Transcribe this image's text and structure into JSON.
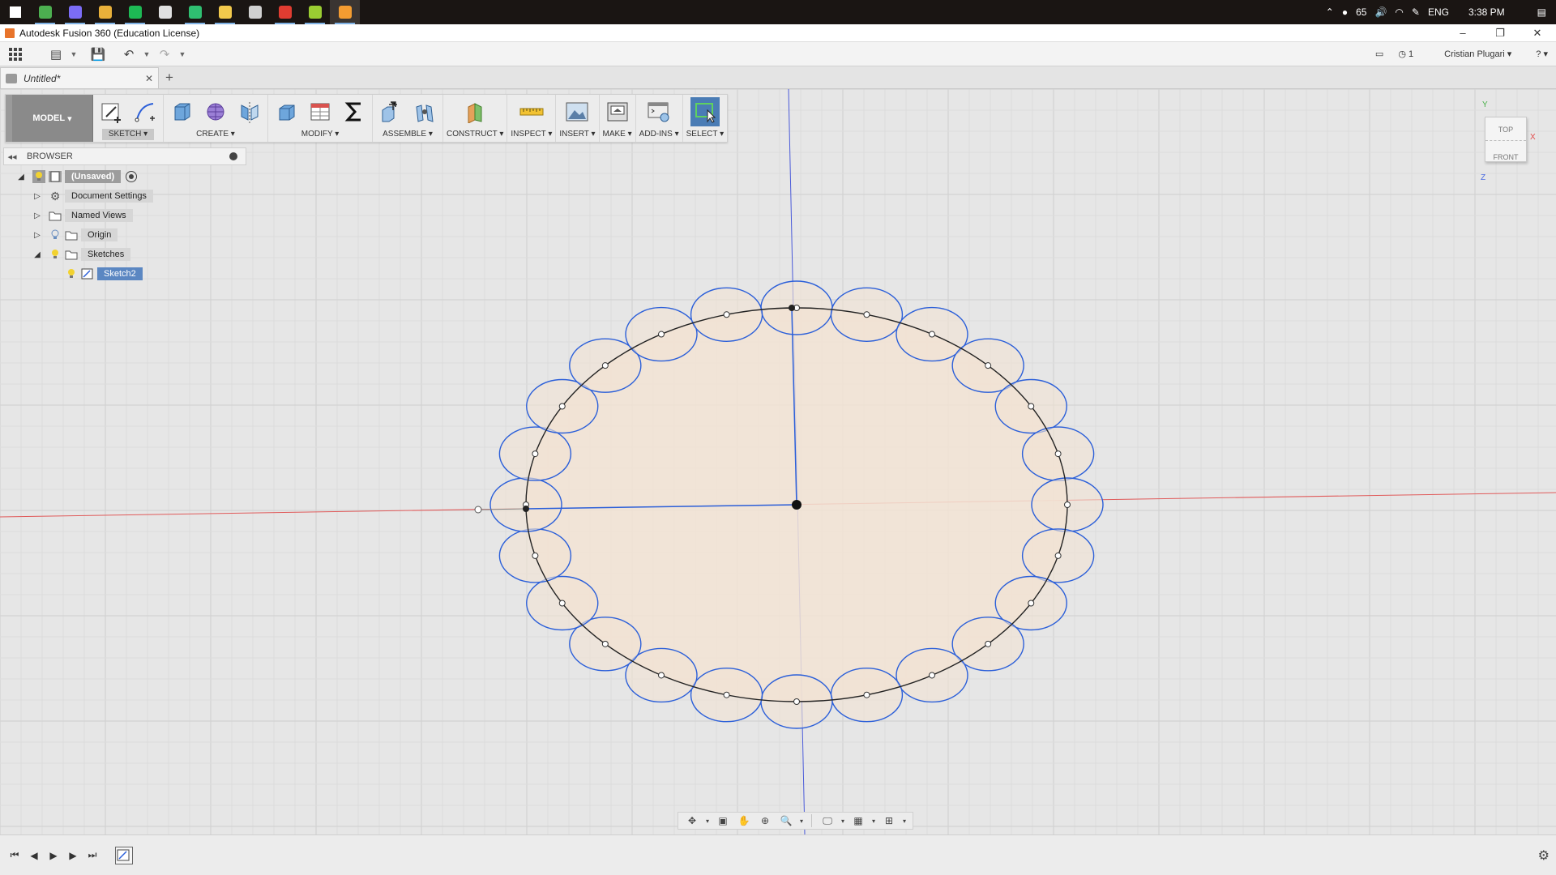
{
  "taskbar": {
    "apps": [
      {
        "name": "start",
        "color": "#ffffff"
      },
      {
        "name": "app-green",
        "color": "#4caf50"
      },
      {
        "name": "app-purple",
        "color": "#7b6cf6"
      },
      {
        "name": "app-chrome",
        "color": "#e8b03a"
      },
      {
        "name": "app-spotify",
        "color": "#1db954"
      },
      {
        "name": "app-git",
        "color": "#e0e0e0"
      },
      {
        "name": "app-green2",
        "color": "#2fbf71"
      },
      {
        "name": "app-files",
        "color": "#f2c94c"
      },
      {
        "name": "app-calc",
        "color": "#d0d0d0"
      },
      {
        "name": "app-pdf",
        "color": "#e03c31"
      },
      {
        "name": "app-edit",
        "color": "#9acd32"
      },
      {
        "name": "app-fusion",
        "color": "#f39c31"
      }
    ],
    "temp": "65",
    "lang": "ENG",
    "time": "3:38 PM"
  },
  "window": {
    "title": "Autodesk Fusion 360 (Education License)",
    "min": "–",
    "max": "❐",
    "close": "✕"
  },
  "apptoolbar": {
    "jobs_count": "1",
    "user": "Cristian Plugari",
    "help": "?"
  },
  "tab": {
    "title": "Untitled*",
    "close": "✕",
    "new": "+"
  },
  "ribbon": {
    "workspace": "MODEL",
    "groups": [
      {
        "label": "SKETCH",
        "active": true
      },
      {
        "label": "CREATE"
      },
      {
        "label": "MODIFY"
      },
      {
        "label": "ASSEMBLE"
      },
      {
        "label": "CONSTRUCT"
      },
      {
        "label": "INSPECT"
      },
      {
        "label": "INSERT"
      },
      {
        "label": "MAKE"
      },
      {
        "label": "ADD-INS"
      },
      {
        "label": "SELECT"
      }
    ]
  },
  "browser": {
    "title": "BROWSER",
    "nodes": [
      {
        "label": "(Unsaved)",
        "type": "root"
      },
      {
        "label": "Document Settings",
        "type": "settings"
      },
      {
        "label": "Named Views",
        "type": "folder"
      },
      {
        "label": "Origin",
        "type": "folder"
      },
      {
        "label": "Sketches",
        "type": "folder"
      },
      {
        "label": "Sketch2",
        "type": "sketch",
        "selected": true
      }
    ]
  },
  "viewcube": {
    "top": "TOP",
    "front": "FRONT",
    "axis_x": "X",
    "axis_y": "Y",
    "axis_z": "Z"
  },
  "sketch": {
    "small_circle_count": 24,
    "colors": {
      "profile": "#2b5fd9",
      "fill": "#f2e3d3",
      "axis_red": "#e05a5a",
      "axis_blue": "#4a5ad9"
    }
  }
}
